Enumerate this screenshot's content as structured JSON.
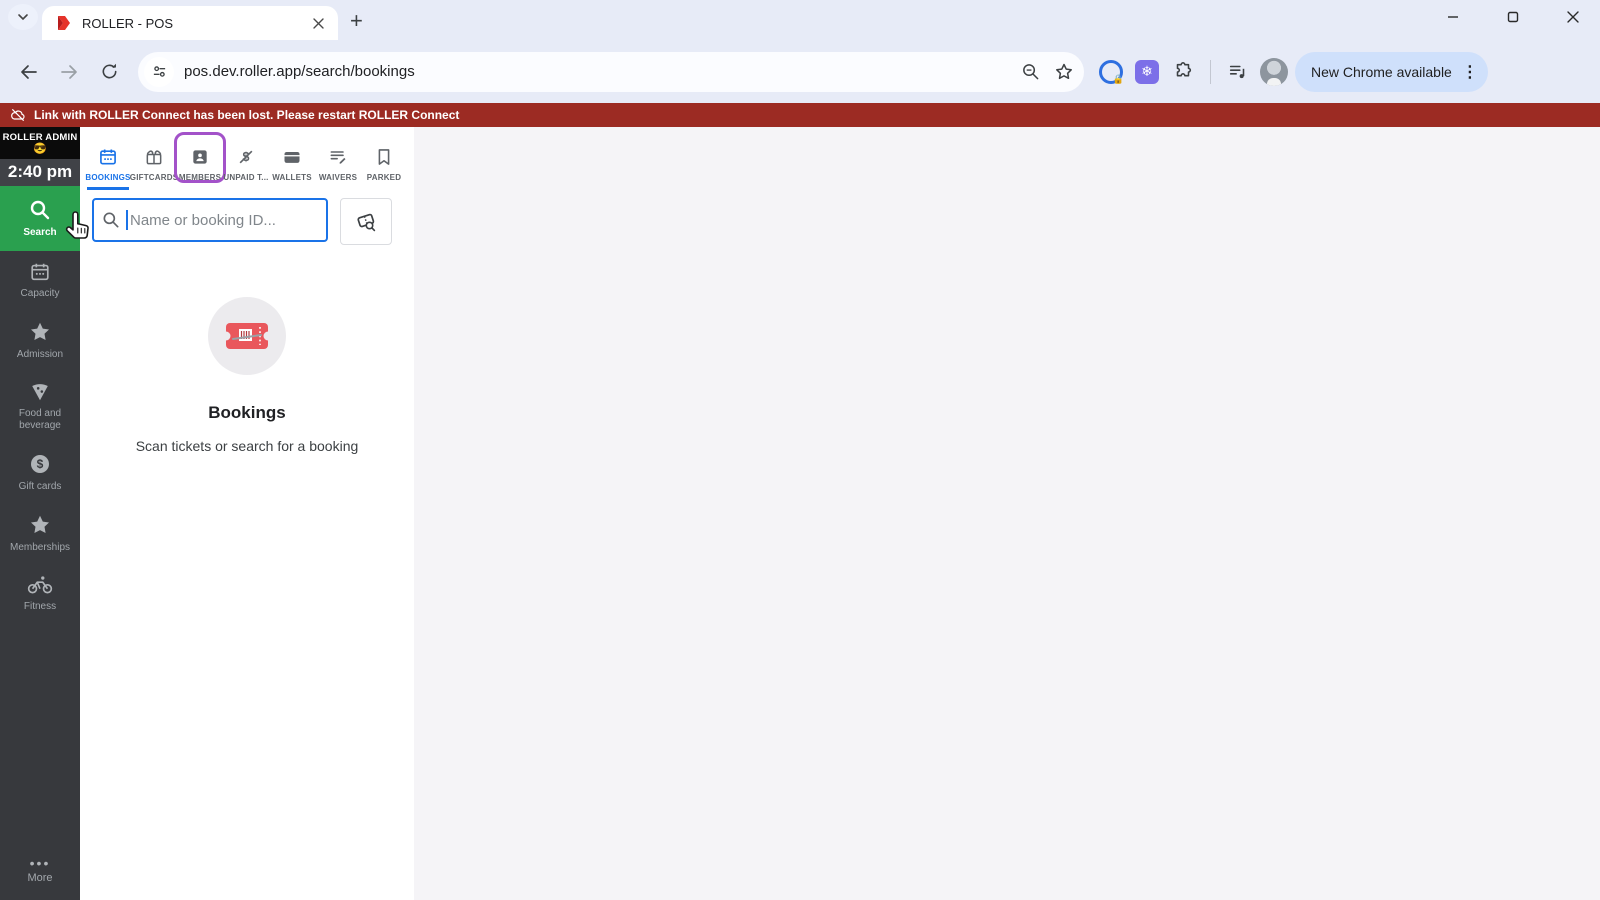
{
  "browser": {
    "tab_title": "ROLLER - POS",
    "url": "pos.dev.roller.app/search/bookings",
    "update_pill": "New Chrome available"
  },
  "banner": {
    "message": "Link with ROLLER Connect has been lost. Please restart ROLLER Connect"
  },
  "sidebar": {
    "brand": "ROLLER ADMIN",
    "brand_emoji": "😎",
    "time": "2:40 pm",
    "items": [
      {
        "label": "Search",
        "active": true
      },
      {
        "label": "Capacity",
        "active": false
      },
      {
        "label": "Admission",
        "active": false
      },
      {
        "label": "Food and beverage",
        "active": false
      },
      {
        "label": "Gift cards",
        "active": false
      },
      {
        "label": "Memberships",
        "active": false
      },
      {
        "label": "Fitness",
        "active": false
      }
    ],
    "more_label": "More"
  },
  "pos_tabs": [
    {
      "label": "BOOKINGS",
      "active": true,
      "highlighted": false
    },
    {
      "label": "GIFTCARDS",
      "active": false,
      "highlighted": false
    },
    {
      "label": "MEMBERS",
      "active": false,
      "highlighted": true
    },
    {
      "label": "UNPAID T...",
      "active": false,
      "highlighted": false
    },
    {
      "label": "WALLETS",
      "active": false,
      "highlighted": false
    },
    {
      "label": "WAIVERS",
      "active": false,
      "highlighted": false
    },
    {
      "label": "PARKED",
      "active": false,
      "highlighted": false
    }
  ],
  "search": {
    "placeholder": "Name or booking ID..."
  },
  "empty_state": {
    "title": "Bookings",
    "subtitle": "Scan tickets or search for a booking"
  },
  "colors": {
    "accent_green": "#2AA04F",
    "accent_blue": "#1A73E8",
    "banner_red": "#9C2B23",
    "highlight_purple": "#A352C9",
    "ticket_red": "#E9575C",
    "sidebar_bg": "#37393D"
  }
}
